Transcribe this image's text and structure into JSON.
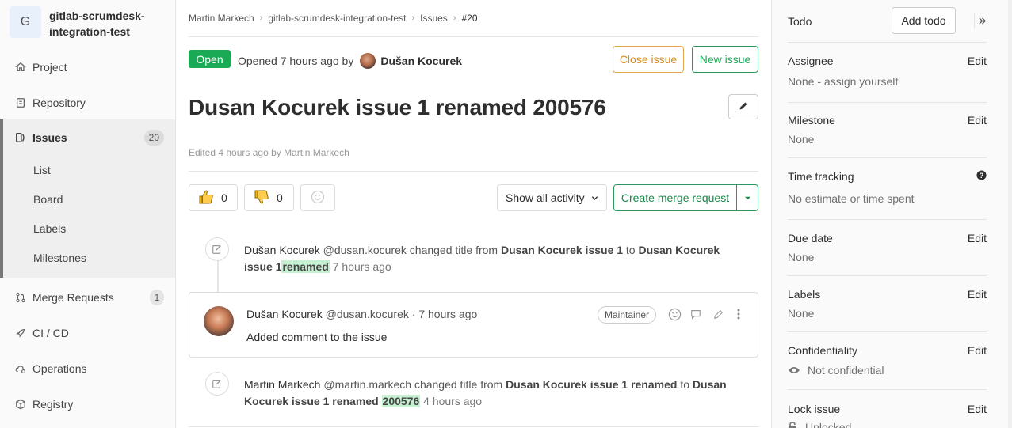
{
  "sidebar": {
    "project_initial": "G",
    "project_name": "gitlab-scrumdesk-integration-test",
    "items": [
      {
        "label": "Project"
      },
      {
        "label": "Repository"
      },
      {
        "label": "Issues",
        "count": "20"
      },
      {
        "label": "Merge Requests",
        "count": "1"
      },
      {
        "label": "CI / CD"
      },
      {
        "label": "Operations"
      },
      {
        "label": "Registry"
      }
    ],
    "issues_sub": [
      "List",
      "Board",
      "Labels",
      "Milestones"
    ]
  },
  "breadcrumb": [
    "Martin Markech",
    "gitlab-scrumdesk-integration-test",
    "Issues",
    "#20"
  ],
  "issue": {
    "status": "Open",
    "opened_text": "Opened 7 hours ago by",
    "author": "Dušan Kocurek",
    "close_label": "Close issue",
    "new_label": "New issue",
    "title": "Dusan Kocurek issue 1 renamed 200576",
    "edited": "Edited 4 hours ago by Martin Markech",
    "thumbs_up": "0",
    "thumbs_down": "0",
    "activity_filter": "Show all activity",
    "create_mr": "Create merge request"
  },
  "timeline": {
    "note1": {
      "author": "Dušan Kocurek",
      "handle": "@dusan.kocurek",
      "text1": "changed title from",
      "from": "Dusan Kocurek issue 1",
      "to_word": "to",
      "to": "Dusan Kocurek issue 1",
      "added": "renamed",
      "time": "7 hours ago"
    },
    "comment": {
      "author": "Dušan Kocurek",
      "handle": "@dusan.kocurek",
      "sep": "·",
      "time": "7 hours ago",
      "role": "Maintainer",
      "body": "Added comment to the issue"
    },
    "note2": {
      "author": "Martin Markech",
      "handle": "@martin.markech",
      "text1": "changed title from",
      "from": "Dusan Kocurek issue 1 renamed",
      "to_word": "to",
      "to": "Dusan Kocurek issue 1 renamed",
      "added": "200576",
      "time": "4 hours ago"
    }
  },
  "right": {
    "todo_label": "Todo",
    "add_todo": "Add todo",
    "assignee_title": "Assignee",
    "assignee_value": "None -",
    "assign_link": "assign yourself",
    "milestone_title": "Milestone",
    "milestone_value": "None",
    "time_title": "Time tracking",
    "time_value": "No estimate or time spent",
    "due_title": "Due date",
    "due_value": "None",
    "labels_title": "Labels",
    "labels_value": "None",
    "conf_title": "Confidentiality",
    "conf_value": "Not confidential",
    "lock_title": "Lock issue",
    "lock_value": "Unlocked",
    "edit_label": "Edit"
  }
}
